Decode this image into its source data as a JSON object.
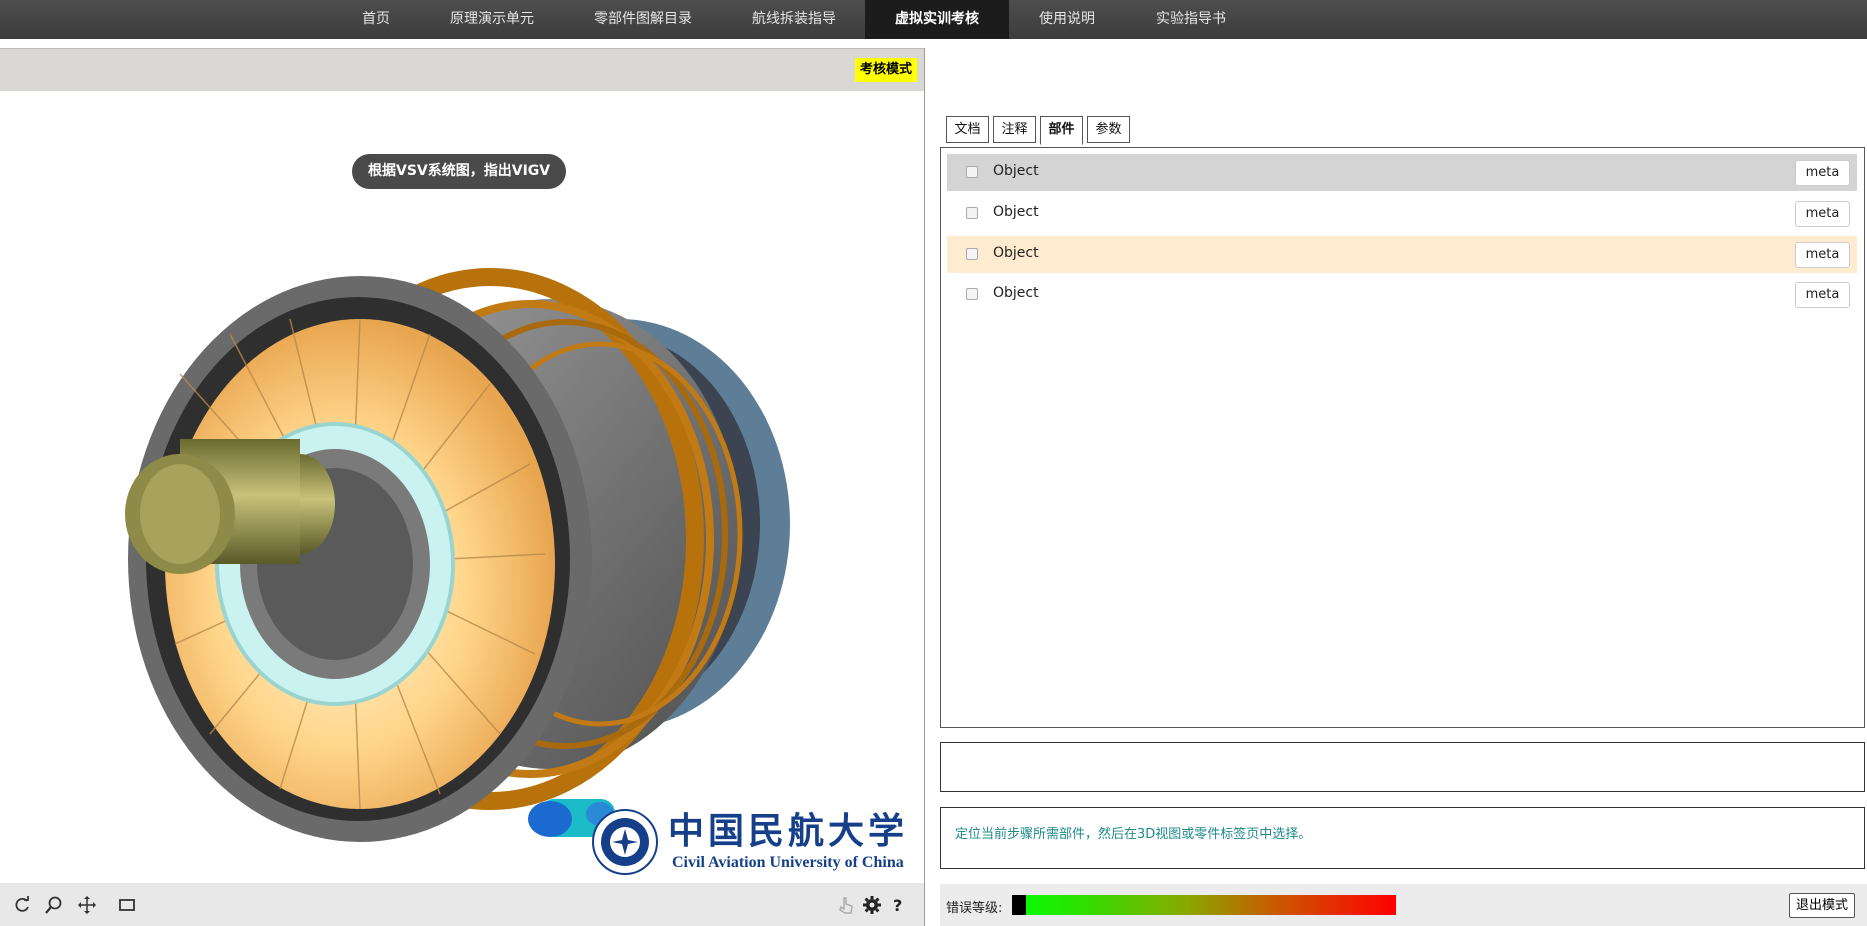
{
  "nav": {
    "items": [
      {
        "label": "首页",
        "active": false
      },
      {
        "label": "原理演示单元",
        "active": false
      },
      {
        "label": "零部件图解目录",
        "active": false
      },
      {
        "label": "航线拆装指导",
        "active": false
      },
      {
        "label": "虚拟实训考核",
        "active": true
      },
      {
        "label": "使用说明",
        "active": false
      },
      {
        "label": "实验指导书",
        "active": false
      }
    ]
  },
  "viewer": {
    "mode_badge": "考核模式",
    "task_prompt": "根据VSV系统图，指出VIGV",
    "logo": {
      "name_cn": "中国民航大学",
      "name_en": "Civil Aviation University of China"
    },
    "toolbar": {
      "left_icons": [
        "rotate-icon",
        "zoom-icon",
        "pan-icon",
        "fit-window-icon"
      ],
      "right_icons": [
        "cursor-icon",
        "settings-icon",
        "help-icon"
      ]
    }
  },
  "panel": {
    "tabs": [
      {
        "label": "文档",
        "active": false
      },
      {
        "label": "注释",
        "active": false
      },
      {
        "label": "部件",
        "active": true
      },
      {
        "label": "参数",
        "active": false
      }
    ],
    "rows": [
      {
        "label": "Object",
        "meta": "meta",
        "state": "selected"
      },
      {
        "label": "Object",
        "meta": "meta",
        "state": "normal"
      },
      {
        "label": "Object",
        "meta": "meta",
        "state": "hover"
      },
      {
        "label": "Object",
        "meta": "meta",
        "state": "normal"
      }
    ],
    "hint": "定位当前步骤所需部件，然后在3D视图或零件标签页中选择。",
    "error_label": "错误等级:",
    "error_level": 0,
    "exit_button": "退出模式"
  },
  "colors": {
    "nav_bg": "#444444",
    "nav_active": "#1c1c1c",
    "badge": "#ffff00",
    "row_selected": "#d4d4d4",
    "row_hover": "#ffecd0",
    "hint_text": "#1e8a8a",
    "logo_blue": "#163f8a"
  }
}
